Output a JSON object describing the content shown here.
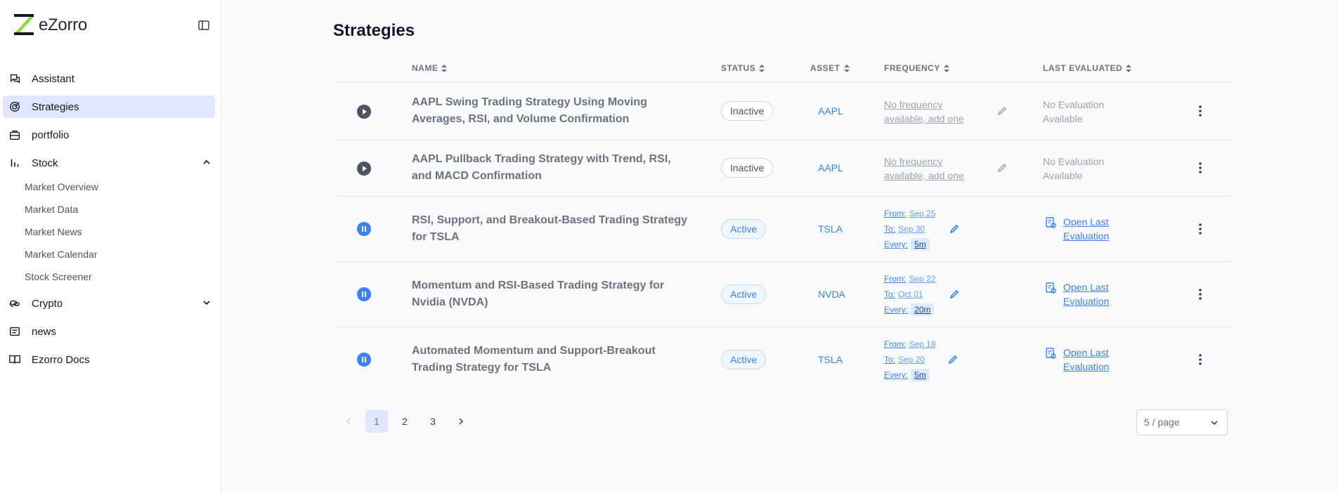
{
  "app": {
    "name": "eZorro"
  },
  "colors": {
    "accent": "#3b82f6",
    "active_nav_bg": "#e0e7ff",
    "logo_green": "#84e03a"
  },
  "sidebar": {
    "items": [
      {
        "label": "Assistant",
        "icon": "chat-icon"
      },
      {
        "label": "Strategies",
        "icon": "target-icon",
        "active": true
      },
      {
        "label": "portfolio",
        "icon": "briefcase-icon"
      },
      {
        "label": "Stock",
        "icon": "bar-chart-icon",
        "expanded": true,
        "children": [
          "Market Overview",
          "Market Data",
          "Market News",
          "Market Calendar",
          "Stock Screener"
        ]
      },
      {
        "label": "Crypto",
        "icon": "coins-icon",
        "expanded": false
      },
      {
        "label": "news",
        "icon": "newspaper-icon"
      },
      {
        "label": "Ezorro Docs",
        "icon": "book-icon"
      }
    ]
  },
  "page": {
    "title": "Strategies"
  },
  "table": {
    "columns": {
      "name": "NAME",
      "status": "STATUS",
      "asset": "ASSET",
      "frequency": "FREQUENCY",
      "last_evaluated": "LAST EVALUATED"
    },
    "rows": [
      {
        "name": "AAPL Swing Trading Strategy Using Moving Averages, RSI, and Volume Confirmation",
        "status": "Inactive",
        "asset": "AAPL",
        "frequency_text": "No frequency available, add one",
        "evaluation": "No Evaluation Available"
      },
      {
        "name": "AAPL Pullback Trading Strategy with Trend, RSI, and MACD Confirmation",
        "status": "Inactive",
        "asset": "AAPL",
        "frequency_text": "No frequency available, add one",
        "evaluation": "No Evaluation Available"
      },
      {
        "name": "RSI, Support, and Breakout-Based Trading Strategy for TSLA",
        "status": "Active",
        "asset": "TSLA",
        "from": "Sep 25",
        "to": "Sep 30",
        "every": "5m",
        "evaluation": "Open Last Evaluation"
      },
      {
        "name": "Momentum and RSI-Based Trading Strategy for Nvidia (NVDA)",
        "status": "Active",
        "asset": "NVDA",
        "from": "Sep 22",
        "to": "Oct 01",
        "every": "20m",
        "evaluation": "Open Last Evaluation"
      },
      {
        "name": "Automated Momentum and Support-Breakout Trading Strategy for TSLA",
        "status": "Active",
        "asset": "TSLA",
        "from": "Sep 18",
        "to": "Sep 20",
        "every": "5m",
        "evaluation": "Open Last Evaluation"
      }
    ],
    "freq_labels": {
      "from": "From:",
      "to": "To:",
      "every": "Every:"
    }
  },
  "pagination": {
    "pages": [
      "1",
      "2",
      "3"
    ],
    "current": "1",
    "page_size": "5 / page"
  }
}
